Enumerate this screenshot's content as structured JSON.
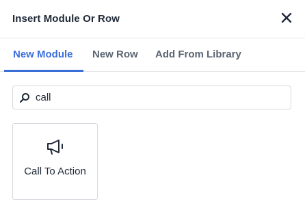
{
  "dialog": {
    "title": "Insert Module Or Row",
    "close_icon": "close-icon"
  },
  "tabs": [
    {
      "label": "New Module",
      "active": true
    },
    {
      "label": "New Row",
      "active": false
    },
    {
      "label": "Add From Library",
      "active": false
    }
  ],
  "search": {
    "value": "call",
    "icon": "search-icon"
  },
  "modules": [
    {
      "label": "Call To Action",
      "icon": "megaphone-icon"
    }
  ],
  "colors": {
    "accent": "#3b6fd8",
    "tab_inactive": "#5a6572",
    "border": "#d6d9de",
    "text": "#1f2937"
  }
}
